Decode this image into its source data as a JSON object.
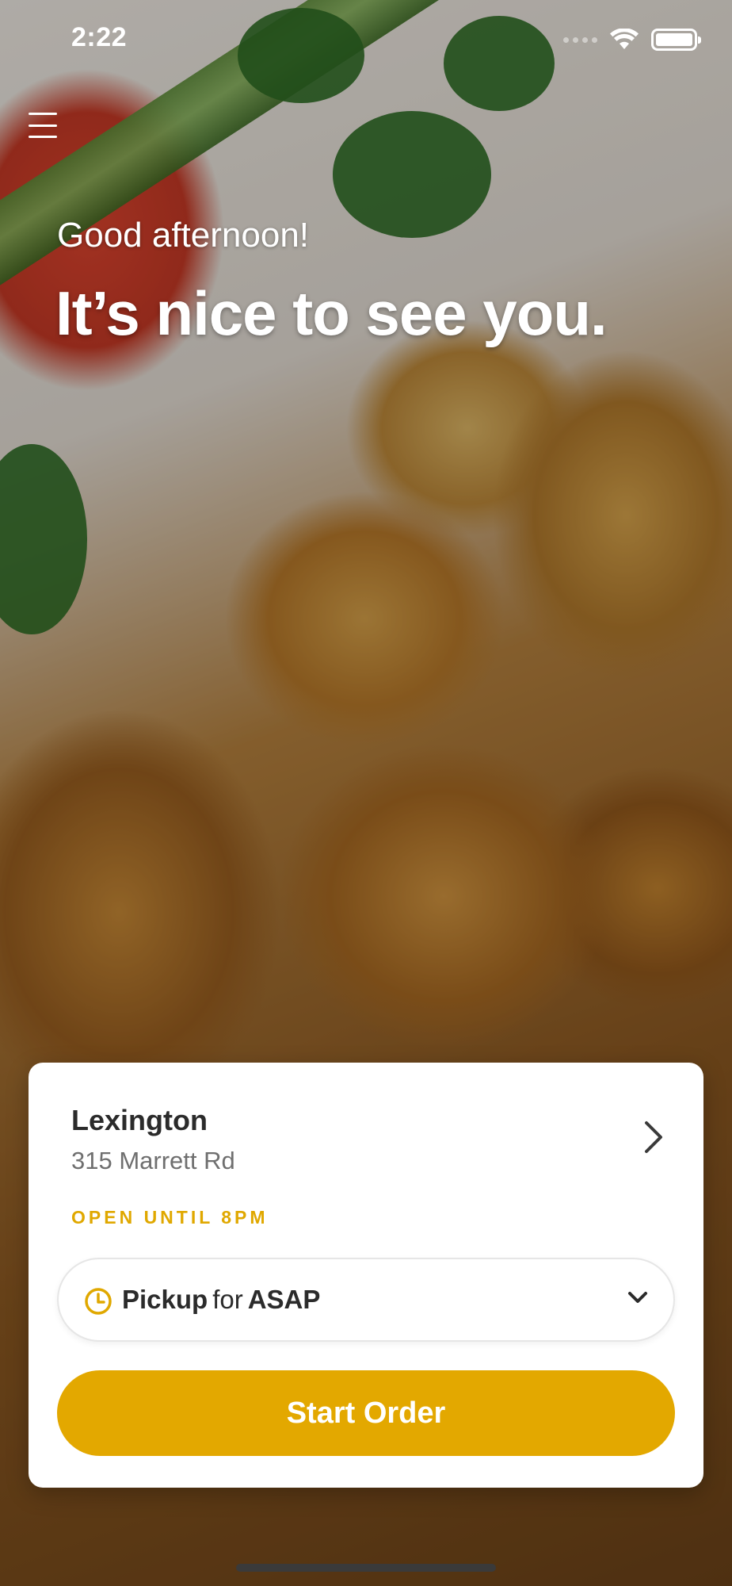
{
  "status_bar": {
    "time": "2:22"
  },
  "header": {
    "menu_icon": "hamburger-menu-icon"
  },
  "greeting": {
    "subtitle": "Good afternoon!",
    "title": "It’s nice to see you."
  },
  "location_card": {
    "name": "Lexington",
    "address": "315 Marrett Rd",
    "hours": "OPEN UNTIL 8PM",
    "hours_color": "#e0a800"
  },
  "order_mode": {
    "method": "Pickup",
    "connector": "for",
    "time": "ASAP",
    "icon": "clock-icon"
  },
  "primary_action": {
    "label": "Start Order",
    "color": "#e3a800"
  }
}
